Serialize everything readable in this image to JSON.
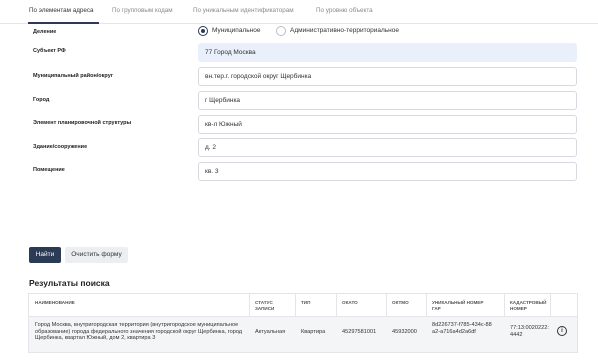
{
  "tabs": [
    {
      "label": "По элементам адреса",
      "active": true
    },
    {
      "label": "По групповым кодам"
    },
    {
      "label": "По уникальным идентификаторам"
    },
    {
      "label": "По уровню объекта"
    }
  ],
  "form": {
    "division": {
      "label": "Деление",
      "options": [
        "Муниципальное",
        "Административно-территориальное"
      ],
      "selected": "Муниципальное"
    },
    "fields": [
      {
        "label": "Субъект РФ",
        "value": "77 Город Москва"
      },
      {
        "label": "Муниципальный район/округ",
        "value": "вн.тер.г. городской округ Щербинка"
      },
      {
        "label": "Город",
        "value": "г Щербинка"
      },
      {
        "label": "Элемент планировочной структуры",
        "value": "кв-л Южный"
      },
      {
        "label": "Здание/сооружение",
        "value": "д. 2"
      },
      {
        "label": "Помещение",
        "value": "кв. 3"
      }
    ]
  },
  "buttons": {
    "find": "Найти",
    "clear": "Очистить форму"
  },
  "results": {
    "title": "Результаты поиска",
    "headers": [
      "Наименование",
      "Статус записи",
      "Тип",
      "ОКАТО",
      "ОКТМО",
      "Уникальный номер ГАР",
      "Кадастровый номер"
    ],
    "rows": [
      {
        "name": "Город Москва, внутригородская территория (внутригородское муниципальное образование) города федерального значения городской округ Щербинка, город Щербинка, квартал Южный, дом 2, квартира 3",
        "status": "Актуальная",
        "type": "Квартира",
        "okato": "45297581001",
        "oktmo": "45932000",
        "gar": "8d226737-f785-434c-88a2-a716a4d2a6df",
        "cadastral": "77:13:0020222:4442"
      }
    ]
  }
}
